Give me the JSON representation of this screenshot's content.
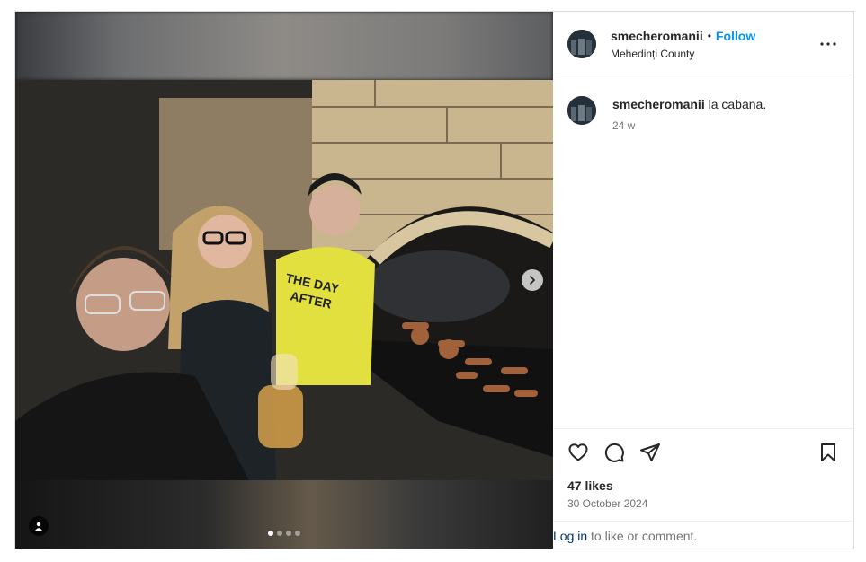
{
  "post": {
    "username": "smecheromanii",
    "follow_label": "Follow",
    "separator": "•",
    "location": "Mehedinți County",
    "caption_user": "smecheromanii",
    "caption_text": "la cabana.",
    "time_ago": "24 w",
    "likes": "47 likes",
    "date": "30 October 2024",
    "login_link": "Log in",
    "login_rest": "to like or comment.",
    "photo_shirt_text": "THE DAY AFTER",
    "carousel": {
      "count": 4,
      "active_index": 0
    }
  },
  "icons": {
    "more": "more-options-icon",
    "like": "heart-icon",
    "comment": "comment-icon",
    "share": "share-icon",
    "save": "bookmark-icon",
    "next": "chevron-right-icon",
    "tag": "user-tag-icon"
  },
  "colors": {
    "follow": "#0095f6",
    "link": "#00376b",
    "muted": "#737373"
  }
}
